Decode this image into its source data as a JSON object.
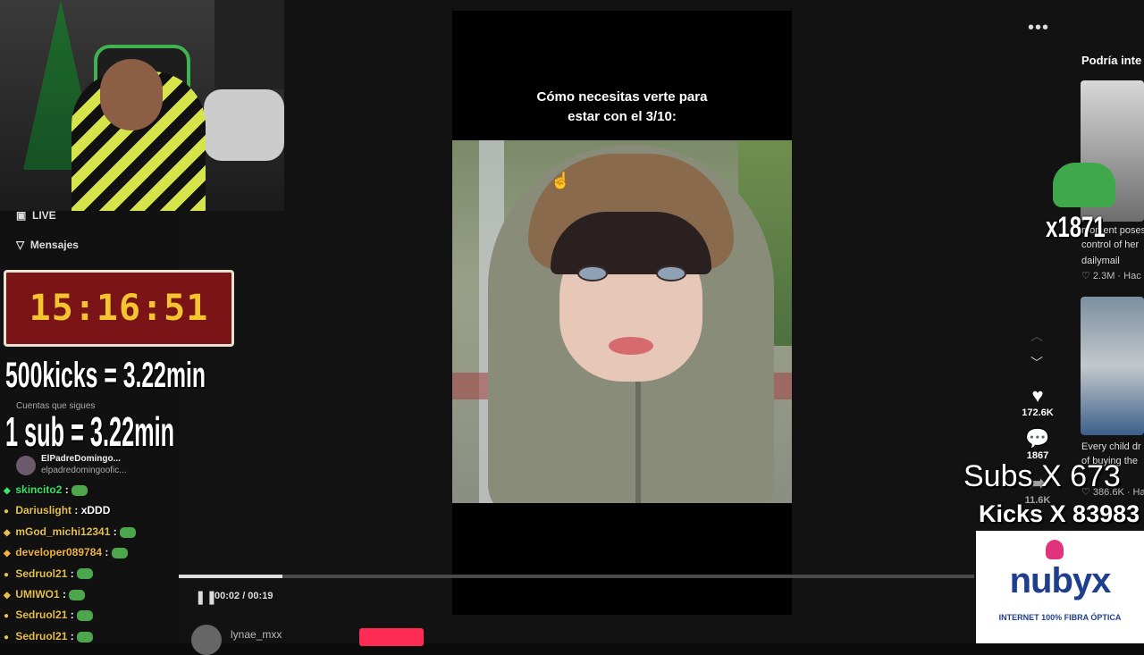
{
  "video": {
    "caption": "Cómo necesitas verte para\nestar con el 3/10:",
    "elapsed": "00:02",
    "duration": "00:19",
    "time_display": "00:02 / 00:19",
    "progress": 0.13,
    "likes": "172.6K",
    "comments": "1867",
    "shares": "11.6K",
    "more_icon": "more-horizontal-icon",
    "author": "lynae_mxx"
  },
  "sidebar": {
    "live_label": "LIVE",
    "messages_label": "Mensajes",
    "following_label": "Cuentas que sigues",
    "account_name": "ElPadreDomingo...",
    "account_handle": "elpadredomingoofic..."
  },
  "suggestions": {
    "title": "Podría inte",
    "items": [
      {
        "line1": "moment poses",
        "line2": "control of her",
        "user": "dailymail",
        "meta": "♡ 2.3M · Hac"
      },
      {
        "line1": "Every child dr",
        "line2": "of buying the",
        "meta": "♡ 386.6K · Ha"
      }
    ]
  },
  "stream_overlay": {
    "timer": "15:16:51",
    "kicks_rate": "500kicks = 3.22min",
    "sub_rate": "1 sub = 3.22min",
    "emote_count": "x1871",
    "subs_counter": "Subs X 673",
    "kicks_counter": "Kicks X 83983",
    "ad_brand": "nubyx",
    "ad_tagline": "INTERNET 100% FIBRA ÓPTICA"
  },
  "chat": [
    {
      "user": "skincito2",
      "color": "#3be36b",
      "badge": "◆",
      "msg": ":"
    },
    {
      "user": "Dariuslight",
      "color": "#e6c14a",
      "badge": "●",
      "msg": ": xDDD"
    },
    {
      "user": "mGod_michi12341",
      "color": "#e6c14a",
      "badge": "◆",
      "msg": ":"
    },
    {
      "user": "developer089784",
      "color": "#f0b43c",
      "badge": "◆",
      "msg": ":"
    },
    {
      "user": "Sedruol21",
      "color": "#e6c14a",
      "badge": "●",
      "msg": ":"
    },
    {
      "user": "UMIWO1",
      "color": "#e6c14a",
      "badge": "◆",
      "msg": ":"
    },
    {
      "user": "Sedruol21",
      "color": "#e6c14a",
      "badge": "●",
      "msg": ":"
    },
    {
      "user": "Sedruol21",
      "color": "#e6c14a",
      "badge": "●",
      "msg": ":"
    }
  ],
  "colors": {
    "accent": "#fe2c55",
    "timer_bg": "#7a1416",
    "timer_text": "#f4c531",
    "brand": "#1f3e8e"
  }
}
